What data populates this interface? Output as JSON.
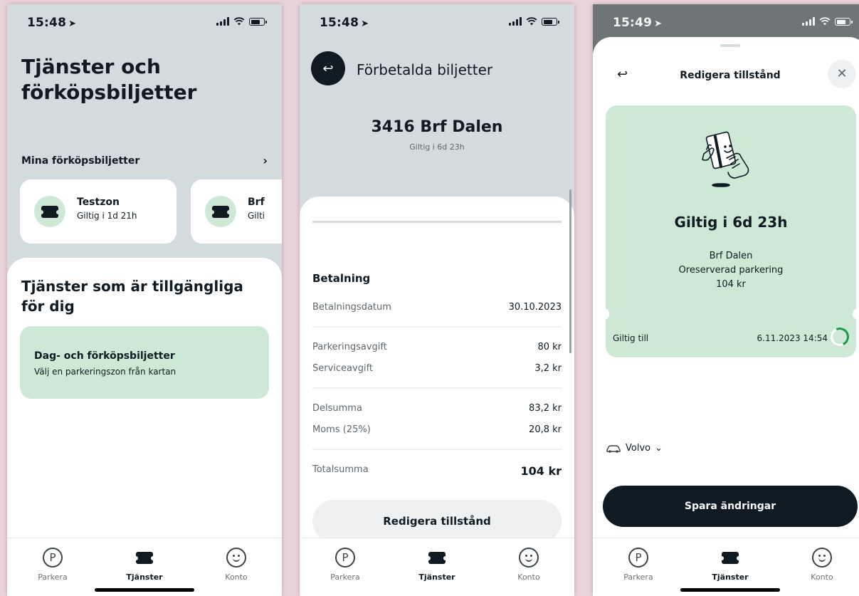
{
  "status": {
    "time1": "15:48",
    "time2": "15:48",
    "time3": "15:49"
  },
  "tabs": {
    "parkera": "Parkera",
    "tjanster": "Tjänster",
    "konto": "Konto"
  },
  "screen1": {
    "title": "Tjänster och förköpsbiljetter",
    "mine_label": "Mina förköpsbiljetter",
    "tickets": [
      {
        "name": "Testzon",
        "valid": "Giltig i 1d 21h"
      },
      {
        "name": "Brf",
        "valid": "Gilti"
      }
    ],
    "services_title": "Tjänster som är tillgängliga för dig",
    "service": {
      "title": "Dag- och förköpsbiljetter",
      "subtitle": "Välj en parkeringszon från kartan"
    }
  },
  "screen2": {
    "header_title": "Förbetalda biljetter",
    "zone": "3416 Brf Dalen",
    "valid": "Giltig i 6d 23h",
    "section": "Betalning",
    "rows": [
      {
        "k": "Betalningsdatum",
        "v": "30.10.2023"
      },
      {
        "k": "Parkeringsavgift",
        "v": "80 kr"
      },
      {
        "k": "Serviceavgift",
        "v": "3,2 kr"
      },
      {
        "k": "Delsumma",
        "v": "83,2 kr"
      },
      {
        "k": "Moms (25%)",
        "v": "20,8 kr"
      },
      {
        "k": "Totalsumma",
        "v": "104 kr"
      }
    ],
    "edit_button": "Redigera tillstånd"
  },
  "screen3": {
    "title": "Redigera tillstånd",
    "valid": "Giltig i 6d 23h",
    "lines": [
      "Brf Dalen",
      "Oreserverad parkering",
      "104 kr"
    ],
    "valid_until_label": "Giltig till",
    "valid_until_value": "6.11.2023 14:54",
    "car": "Volvo",
    "save_button": "Spara ändringar"
  }
}
